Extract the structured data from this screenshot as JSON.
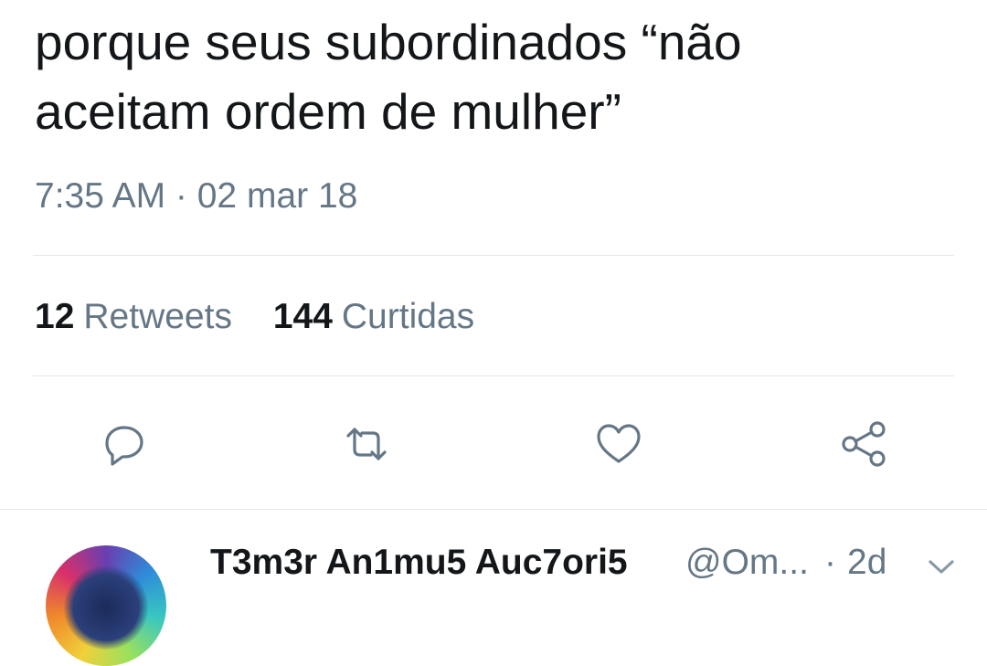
{
  "tweet": {
    "text_line1": "porque seus subordinados “não",
    "text_line2": "aceitam ordem de mulher”",
    "timestamp": "7:35 AM · 02 mar 18"
  },
  "stats": {
    "retweets_count": "12",
    "retweets_label": "Retweets",
    "likes_count": "144",
    "likes_label": "Curtidas"
  },
  "actions": {
    "reply_icon": "reply-icon",
    "retweet_icon": "retweet-icon",
    "like_icon": "heart-icon",
    "share_icon": "share-icon"
  },
  "reply": {
    "name": "T3m3r An1mu5 Auc7ori5",
    "handle": "@Om...",
    "separator": "·",
    "time": "2d"
  },
  "colors": {
    "text": "#14171a",
    "secondary": "#657786",
    "divider": "#e1e8ed"
  }
}
